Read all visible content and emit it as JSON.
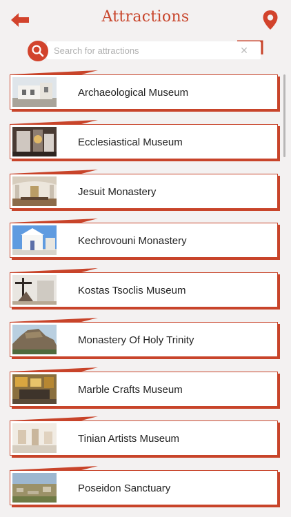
{
  "header": {
    "title": "Attractions",
    "back_icon": "back-arrow-icon",
    "map_icon": "map-pin-icon"
  },
  "search": {
    "placeholder": "Search for attractions",
    "value": "",
    "clear_symbol": "✕"
  },
  "colors": {
    "accent": "#c8442a",
    "background": "#f3f1f1",
    "card": "#ffffff",
    "text": "#222222"
  },
  "attractions": [
    {
      "name": "Archaeological Museum",
      "thumb": "museum-building-photo"
    },
    {
      "name": "Ecclesiastical Museum",
      "thumb": "church-interior-photo"
    },
    {
      "name": "Jesuit Monastery",
      "thumb": "monastery-interior-photo"
    },
    {
      "name": "Kechrovouni Monastery",
      "thumb": "white-church-photo"
    },
    {
      "name": "Kostas Tsoclis Museum",
      "thumb": "sculpture-photo"
    },
    {
      "name": "Monastery Of Holy Trinity",
      "thumb": "rock-hill-photo"
    },
    {
      "name": "Marble Crafts Museum",
      "thumb": "gallery-interior-photo"
    },
    {
      "name": "Tinian Artists Museum",
      "thumb": "sculpture-gallery-photo"
    },
    {
      "name": "Poseidon Sanctuary",
      "thumb": "ruins-photo"
    }
  ]
}
